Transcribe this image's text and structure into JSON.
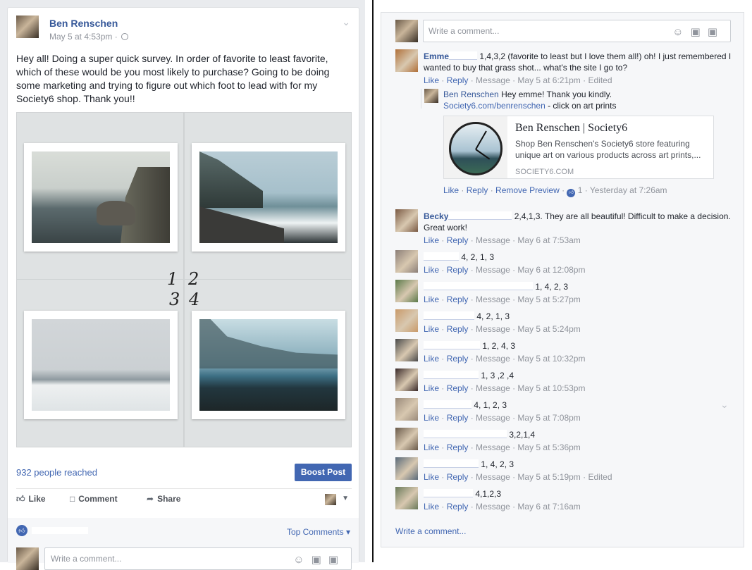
{
  "post": {
    "author": "Ben Renschen",
    "timestamp": "May 5 at 4:53pm · ",
    "text": "Hey all! Doing a super quick survey. In order of favorite to least favorite, which of these would be you most likely to purchase? Going to be doing some marketing and trying to figure out which foot to lead with for my Society6 shop. Thank you!!",
    "image_numbers": [
      "1",
      "2",
      "3",
      "4"
    ],
    "reach": "932 people reached",
    "boost_label": "Boost Post",
    "actions": {
      "like": "Like",
      "comment": "Comment",
      "share": "Share"
    },
    "top_comments": "Top Comments",
    "write_comment_placeholder": "Write a comment..."
  },
  "comments_panel": {
    "write_comment_placeholder": "Write a comment...",
    "meta_words": {
      "like": "Like",
      "reply": "Reply",
      "message": "Message",
      "remove_preview": "Remove Preview"
    },
    "comments": [
      {
        "name_fragment": "Emme",
        "text": "1,4,3,2 (favorite to least but I love them all!) oh! I just remembered I wanted to buy that grass shot... what's the site I go to?",
        "time": "May 5 at 6:21pm",
        "edited": "Edited",
        "avatar_color": "#b0703a"
      },
      {
        "name_fragment": "Becky",
        "text": "2,4,1,3. They are all beautiful! Difficult to make a decision. Great work!",
        "time": "May 6 at 7:53am",
        "edited": "",
        "avatar_color": "#7a5a44"
      },
      {
        "name_fragment": "",
        "text": "4, 2, 1, 3",
        "time": "May 6 at 12:08pm",
        "edited": "",
        "avatar_color": "#8c7f78"
      },
      {
        "name_fragment": "",
        "text": "1, 4, 2, 3",
        "time": "May 5 at 5:27pm",
        "edited": "",
        "avatar_color": "#5c7a4a"
      },
      {
        "name_fragment": "",
        "text": "4, 2, 1, 3",
        "time": "May 5 at 5:24pm",
        "edited": "",
        "avatar_color": "#c99a6a"
      },
      {
        "name_fragment": "",
        "text": "1, 2, 4, 3",
        "time": "May 5 at 10:32pm",
        "edited": "",
        "avatar_color": "#4a4a4a"
      },
      {
        "name_fragment": "",
        "text": "1, 3 ,2 ,4",
        "time": "May 5 at 10:53pm",
        "edited": "",
        "avatar_color": "#3a2a2a"
      },
      {
        "name_fragment": "",
        "text": "4, 1, 2, 3",
        "time": "May 5 at 7:08pm",
        "edited": "",
        "avatar_color": "#9a8a7a"
      },
      {
        "name_fragment": "",
        "text": "3,2,1,4",
        "time": "May 5 at 5:36pm",
        "edited": "",
        "avatar_color": "#6a5a4a"
      },
      {
        "name_fragment": "",
        "text": "1, 4, 2, 3",
        "time": "May 5 at 5:19pm",
        "edited": "Edited",
        "avatar_color": "#5a6a7a"
      },
      {
        "name_fragment": "",
        "text": "4,1,2,3",
        "time": "May 6 at 7:16am",
        "edited": "",
        "avatar_color": "#6a7a5a"
      }
    ],
    "reply": {
      "author": "Ben Renschen",
      "text": "Hey emme! Thank you kindly.",
      "link": "Society6.com/benrenschen",
      "link_suffix": " - click on art prints",
      "card_title": "Ben Renschen | Society6",
      "card_desc": "Shop Ben Renschen's Society6 store featuring unique art on various products across art prints,...",
      "card_domain": "SOCIETY6.COM",
      "like_count": "1",
      "time": "Yesterday at 7:26am"
    },
    "write_comment_link": "Write a comment..."
  }
}
